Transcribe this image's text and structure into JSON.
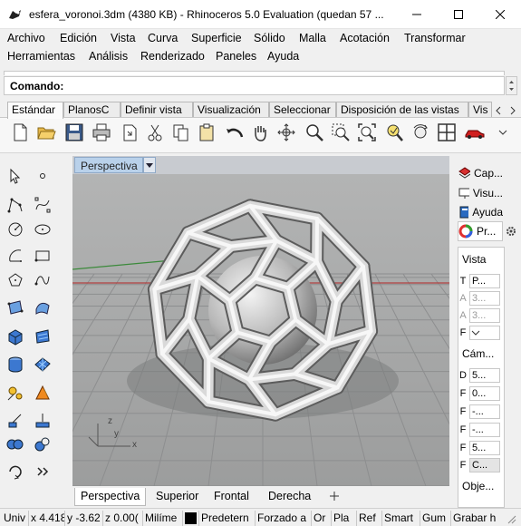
{
  "window": {
    "title": "esfera_voronoi.3dm (4380 KB) - Rhinoceros 5.0 Evaluation (quedan 57 ..."
  },
  "menu": {
    "row1": [
      "Archivo",
      "Edición",
      "Vista",
      "Curva",
      "Superficie",
      "Sólido",
      "Malla",
      "Acotación",
      "Transformar"
    ],
    "row2": [
      "Herramientas",
      "Análisis",
      "Renderizado",
      "Paneles",
      "Ayuda"
    ]
  },
  "command": {
    "label": "Comando:"
  },
  "toolbar_tabs": [
    "Estándar",
    "PlanosC",
    "Definir vista",
    "Visualización",
    "Seleccionar",
    "Disposición de las vistas",
    "Vis"
  ],
  "viewport": {
    "title": "Perspectiva",
    "axis_labels": [
      "z",
      "y",
      "x"
    ]
  },
  "viewport_tabs": [
    "Perspectiva",
    "Superior",
    "Frontal",
    "Derecha"
  ],
  "panel": {
    "tabs": [
      "Cap...",
      "Visu...",
      "Ayuda",
      "Pr..."
    ],
    "section_vista": "Vista",
    "vista_rows": [
      {
        "k": "T",
        "v": "P..."
      },
      {
        "k": "A",
        "v": "3..."
      },
      {
        "k": "A",
        "v": "3..."
      },
      {
        "k": "F",
        "v": ""
      }
    ],
    "section_camara": "Cám...",
    "camara_rows": [
      {
        "k": "D",
        "v": "5..."
      },
      {
        "k": "F",
        "v": "0..."
      },
      {
        "k": "F",
        "v": "-..."
      },
      {
        "k": "F",
        "v": "-..."
      },
      {
        "k": "F",
        "v": "5..."
      },
      {
        "k": "F",
        "v": "C..."
      }
    ],
    "section_obje": "Obje..."
  },
  "status": {
    "fields": [
      "Univ",
      "x 4.418",
      "y -3.62",
      "z 0.00(",
      "Milíme",
      "",
      "Predetern",
      "Forzado a",
      "Or",
      "Pla",
      "Ref",
      "Smart",
      "Gum",
      "Grabar h"
    ]
  },
  "colors": {
    "viewport_bg": "#a7a8a8",
    "viewport_tab": "#b9d1ea",
    "grid": "#8e8f90",
    "x_axis": "#b04040",
    "y_axis": "#3b8a3b"
  }
}
